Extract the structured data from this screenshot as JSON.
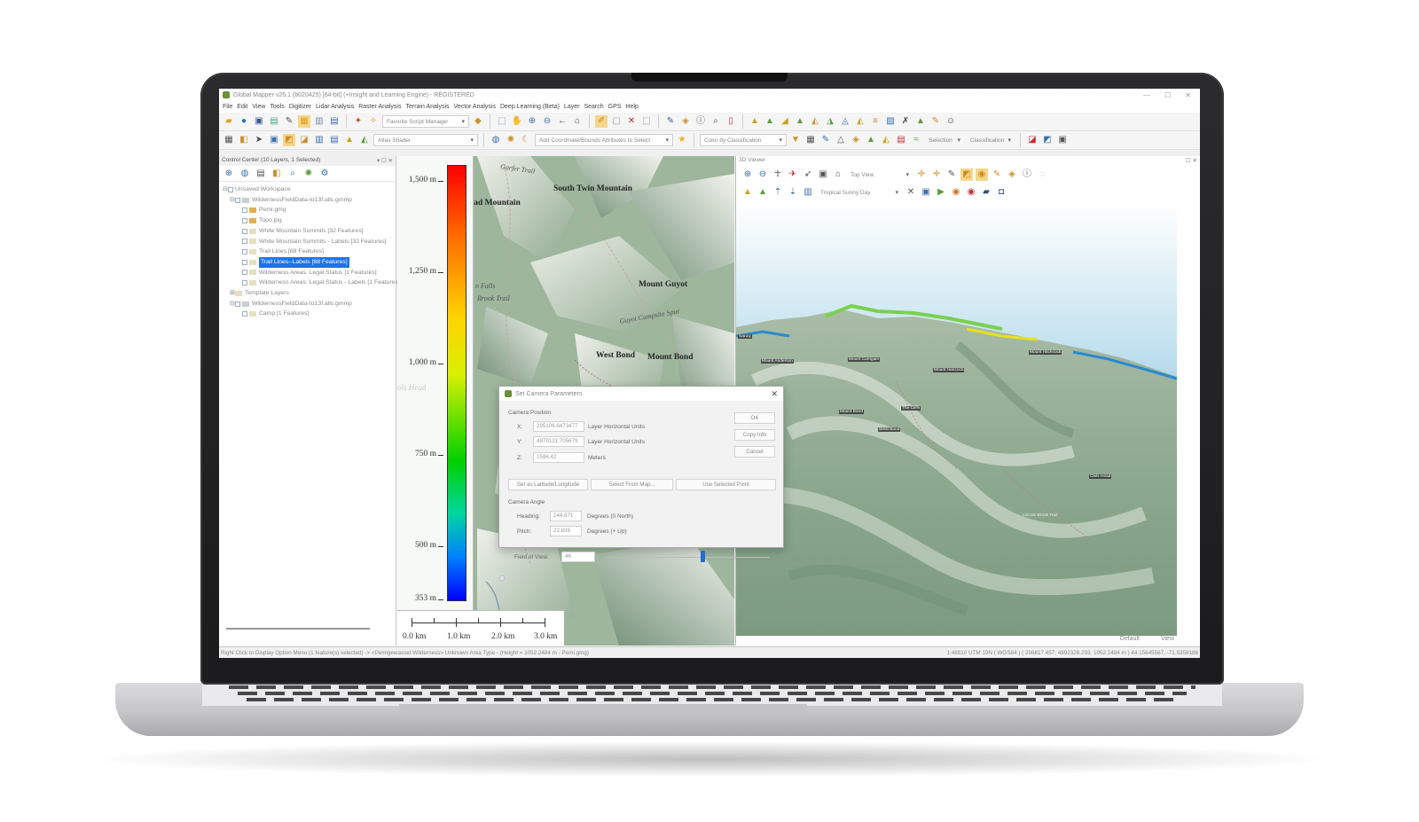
{
  "window": {
    "title": "Global Mapper v26.1 (b020425) [64-bit] (+Insight and Learning Engine) - REGISTERED",
    "controls": [
      "—",
      "☐",
      "✕"
    ]
  },
  "menu": [
    "File",
    "Edit",
    "View",
    "Tools",
    "Digitizer",
    "Lidar Analysis",
    "Raster Analysis",
    "Terrain Analysis",
    "Vector Analysis",
    "Deep Learning (Beta)",
    "Layer",
    "Search",
    "GPS",
    "Help"
  ],
  "toolbar": {
    "script_manager": "Favorite Script Manager",
    "shader": "Atlas Shader",
    "attributes_select": "Add Coordinate/Bounds Attributes to Select",
    "color_by": "Color by Classification",
    "selection": "Selection",
    "classification": "Classification"
  },
  "control_center": {
    "title": "Control Center (10 Layers, 1 Selected)",
    "layers": [
      {
        "label": "Unsaved Workspace",
        "indent": 0
      },
      {
        "label": "WildernessFieldData-to13f.alls.gmmp",
        "indent": 1
      },
      {
        "label": "Pemi.gmg",
        "indent": 2
      },
      {
        "label": "Topo.jpg",
        "indent": 2
      },
      {
        "label": "White Mountain Summits [32 Features]",
        "indent": 2
      },
      {
        "label": "White Mountain Summits - Labels [32 Features]",
        "indent": 2
      },
      {
        "label": "Trail Lines [88 Features]",
        "indent": 2
      },
      {
        "label": "Trail Lines--Labels [88 Features]",
        "indent": 2,
        "selected": true
      },
      {
        "label": "Wilderness Areas: Legal Status [1 Features]",
        "indent": 2
      },
      {
        "label": "Wilderness Areas: Legal Status - Labels [1 Features]",
        "indent": 2
      },
      {
        "label": "Template Layers",
        "indent": 1
      },
      {
        "label": "WildernessFieldData-to13f.alls.gmmp",
        "indent": 1
      },
      {
        "label": "Camp [1 Features]",
        "indent": 2
      }
    ]
  },
  "map2d": {
    "elevation_legend": [
      "1,500 m",
      "1,250 m",
      "1,000 m",
      "750 m",
      "500 m",
      "353 m"
    ],
    "scale_labels": [
      "0.0 km",
      "1.0 km",
      "2.0 km",
      "3.0 km"
    ],
    "labels": {
      "trail": "Garfer Trail",
      "south_twin": "South Twin Mountain",
      "read_mountain": "ead Mountain",
      "falls": "n Falls",
      "brook_trail": "Brook Trail",
      "mount_guyot": "Mount Guyot",
      "guyot_campsite": "Guyot Campsite Spur",
      "west_bond": "West Bond",
      "mount_bond": "Mount Bond",
      "head": "ols Head"
    }
  },
  "viewer3d": {
    "title": "3D Viewer",
    "view_mode": "Top View",
    "sky": "Tropical Sunny Day",
    "labels": {
      "mount_anderson": "Mount Anderson",
      "mount_carrigain": "Mount Carrigain",
      "mount_hancock": "Mount Hancock",
      "mount_bond": "Mount Bond",
      "the_cliffs": "The Cliffs",
      "west_bond": "West Bond",
      "mount_hitchcock": "Mount Hitchcock",
      "owls_head": "Owls Head",
      "nancy": "Nancy",
      "lincoln_brook": "Lincoln Brook Trail"
    },
    "status": [
      "Default",
      "View"
    ]
  },
  "statusbar": {
    "left": "Right Click to Display Option Menu (1 feature(s) selected) -> <Pemigewasset Wilderness> Unknown Area Type - (Height = 1052.2484 m - Pemi.gmg)",
    "right": "1:48810 UTM 19N ( WGS84 ) ( 298817.457, 4892328.293, 1052.2484 m ) 44.15645567, -71.5359186"
  },
  "dialog": {
    "title": "Set Camera Parameters",
    "position_section": "Camera Position",
    "x_label": "X:",
    "x_value": "295106.6473477",
    "x_units": "Layer Horizontal Units",
    "y_label": "Y:",
    "y_value": "4879121.705679",
    "y_units": "Layer Horizontal Units",
    "z_label": "Z:",
    "z_value": "1596.42",
    "z_units": "Meters",
    "ok": "OK",
    "copy_info": "Copy Info",
    "cancel": "Cancel",
    "set_latlong": "Set as Latitude/Longitude",
    "select_from_map": "Select From Map...",
    "use_selected_point": "Use Selected Point",
    "angle_section": "Camera Angle",
    "heading_label": "Heading:",
    "heading_value": "144.671",
    "heading_units": "Degrees (0 North)",
    "pitch_label": "Pitch:",
    "pitch_value": "22.839",
    "pitch_units": "Degrees (+ Up)",
    "fov_label": "Field of View:",
    "fov_value": "46",
    "fov_slider_fraction": 0.59
  },
  "colors": {
    "selection_blue": "#1e73e8",
    "sky_top": "#e8f1f6",
    "terrain_green": "#8fae94"
  }
}
